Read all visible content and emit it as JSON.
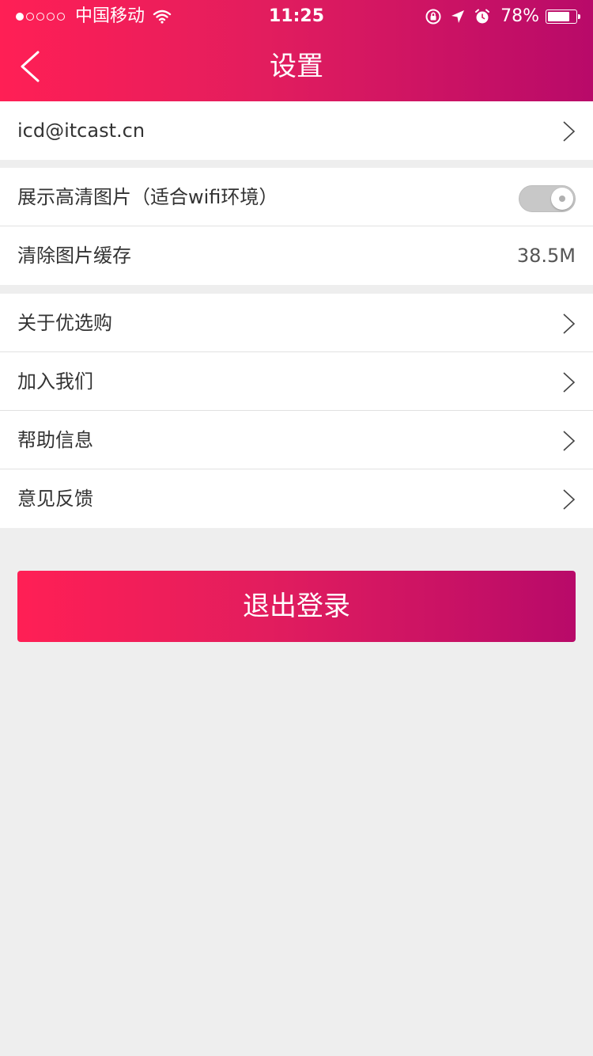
{
  "status_bar": {
    "carrier": "中国移动",
    "time": "11:25",
    "battery_percent": "78%",
    "battery_level": 0.78,
    "signal_bars_filled": 1,
    "signal_bars_total": 5
  },
  "header": {
    "title": "设置",
    "back_icon": "chevron-left-icon"
  },
  "account": {
    "email": "icd@itcast.cn"
  },
  "display_settings": {
    "hd_images_label": "展示高清图片（适合wifi环境）",
    "hd_images_enabled": false,
    "clear_cache_label": "清除图片缓存",
    "cache_size": "38.5M"
  },
  "info_items": [
    {
      "label": "关于优选购"
    },
    {
      "label": "加入我们"
    },
    {
      "label": "帮助信息"
    },
    {
      "label": "意见反馈"
    }
  ],
  "logout_label": "退出登录",
  "colors": {
    "gradient_start": "#ff1f55",
    "gradient_end": "#b80a69",
    "background": "#eeeeee"
  }
}
